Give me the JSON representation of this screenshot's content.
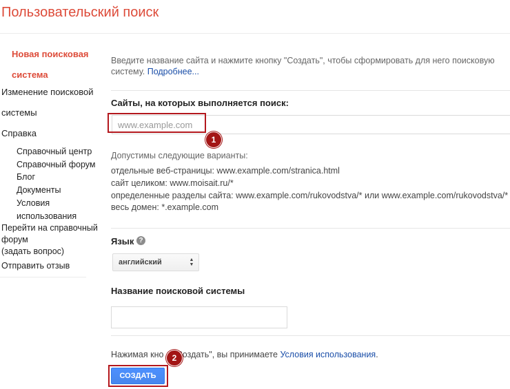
{
  "page": {
    "title": "Пользовательский поиск"
  },
  "sidebar": {
    "active_line1": "Новая поисковая",
    "active_line2": "система",
    "edit_line1": "Изменение поисковой",
    "edit_line2": "системы",
    "help": "Справка",
    "help_items": [
      "Справочный центр",
      "Справочный форум",
      "Блог",
      "Документы",
      "Условия",
      "использования"
    ],
    "forum_line1": "Перейти на справочный",
    "forum_line2": "форум",
    "forum_line3": "(задать вопрос)",
    "feedback": "Отправить отзыв"
  },
  "main": {
    "intro_line1": "Введите название сайта и нажмите кнопку \"Создать\", чтобы сформировать для него поисковую",
    "intro_line2": "систему. ",
    "intro_link": "Подробнее...",
    "sites_label": "Сайты, на которых выполняется поиск:",
    "sites_placeholder": "www.example.com",
    "variants_heading": "Допустимы следующие варианты:",
    "variants": [
      "отдельные веб-страницы: www.example.com/stranica.html",
      "сайт целиком: www.moisait.ru/*",
      "определенные разделы сайта: www.example.com/rukovodstva/* или www.example.com/rukovodstva/*",
      "весь домен: *.example.com"
    ],
    "language_label": "Язык",
    "language_value": "английский",
    "engine_name_label": "Название поисковой системы",
    "terms_prefix": "Нажимая кно",
    "terms_middle": "\"Создать\", вы принимаете ",
    "terms_link": "Условия использования",
    "terms_suffix": ".",
    "create_button": "СОЗДАТЬ"
  },
  "annotations": {
    "badge1": "1",
    "badge2": "2"
  },
  "colors": {
    "accent": "#dd4b39",
    "link": "#1a4ea8",
    "button": "#4d90fe",
    "highlight": "#b3171d"
  }
}
